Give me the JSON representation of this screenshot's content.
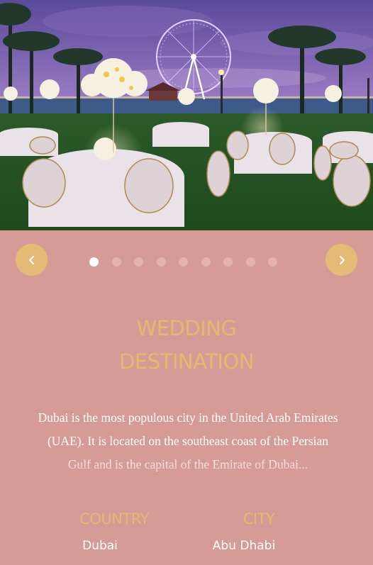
{
  "slider": {
    "image_alt": "Wedding reception dinner tables on a lawn with palm trees and a lit ferris wheel at dusk",
    "slide_count": 9,
    "active_index": 0,
    "prev_icon": "chevron-left-icon",
    "next_icon": "chevron-right-icon"
  },
  "section": {
    "title_line1": "WEDDING",
    "title_line2": "DESTINATION",
    "description": "Dubai is the most populous city in the United Arab Emirates (UAE). It is located on the southeast coast of the Persian Gulf and is the capital of the Emirate of Dubai..."
  },
  "info": {
    "country_label": "COUNTRY",
    "country_value": "Dubai",
    "city_label": "CITY",
    "city_value": "Abu Dhabi"
  },
  "colors": {
    "background": "#d69b97",
    "accent_gold": "#e3b870",
    "text_white": "#ffffff",
    "dot_inactive": "#e4b2ad"
  }
}
